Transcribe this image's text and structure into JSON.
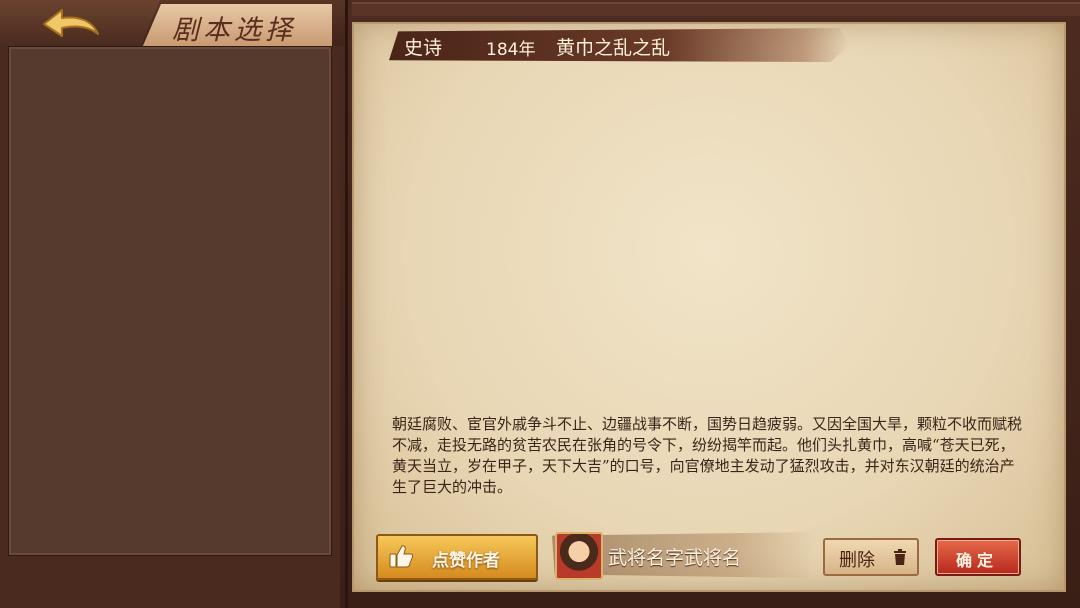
{
  "header": {
    "title": "剧本选择",
    "back_icon": "back-arrow-icon"
  },
  "scenario": {
    "type": "史诗",
    "year": "184年",
    "name": "黄巾之乱之乱",
    "description": "朝廷腐败、宦官外戚争斗不止、边疆战事不断，国势日趋疲弱。又因全国大旱，颗粒不收而赋税不减，走投无路的贫苦农民在张角的号令下，纷纷揭竿而起。他们头扎黄巾，高喊“苍天已死，黄天当立，岁在甲子，天下大吉”的口号，向官僚地主发动了猛烈攻击，并对东汉朝廷的统治产生了巨大的冲击。"
  },
  "footer": {
    "like_label": "点赞作者",
    "like_icon": "thumbs-up-icon",
    "author_name": "武将名字武将名",
    "delete_label": "删除",
    "delete_icon": "trash-icon",
    "confirm_label": "确定"
  },
  "colors": {
    "accent_gold": "#d58a1e",
    "confirm_red": "#b8281e",
    "paper": "#e8d6b4"
  }
}
